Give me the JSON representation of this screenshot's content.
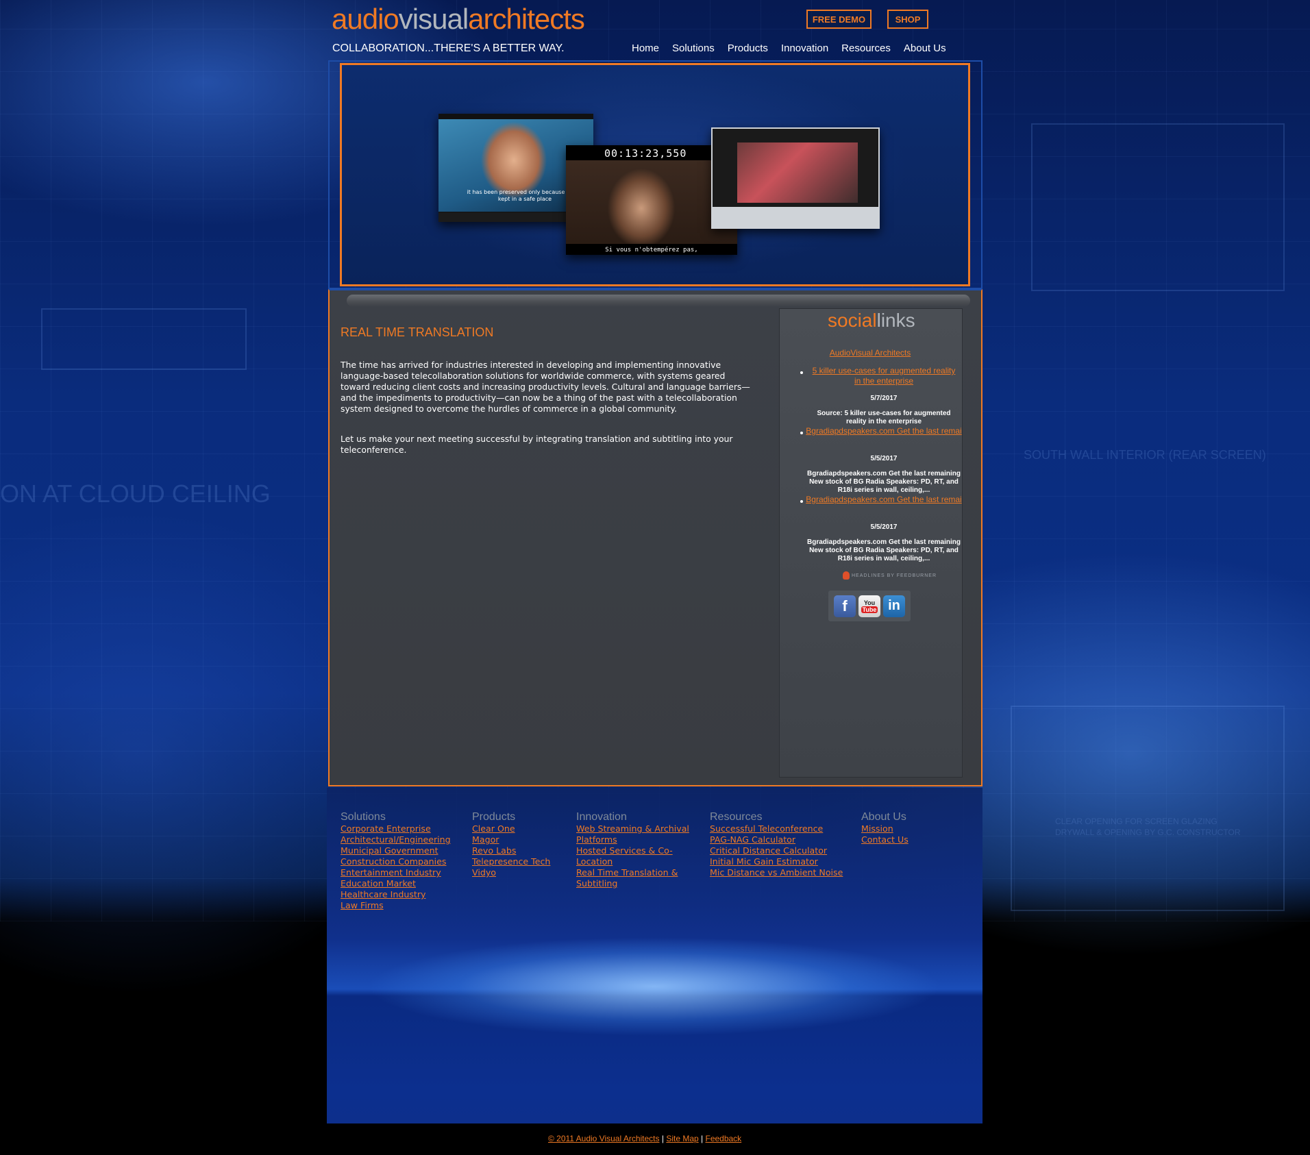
{
  "header": {
    "logo_part1": "audio",
    "logo_part2": "visual",
    "logo_part3": "architects",
    "tagline": "COLLABORATION...THERE'S A BETTER WAY.",
    "free_demo_label": "FREE DEMO",
    "shop_label": "SHOP"
  },
  "nav": {
    "items": [
      {
        "label": "Home"
      },
      {
        "label": "Solutions"
      },
      {
        "label": "Products"
      },
      {
        "label": "Innovation"
      },
      {
        "label": "Resources"
      },
      {
        "label": "About Us"
      }
    ]
  },
  "banner": {
    "video1_subtitle": "it has been preserved only because it was kept in a safe place",
    "video2_timecode": "00:13:23,550",
    "video2_subtitle": "Si vous n'obtempérez pas,"
  },
  "background_text": {
    "left": "ON AT CLOUD CEILING",
    "right": "SOUTH WALL INTERIOR (REAR SCREEN)",
    "bottom_right_1": "CLEAR OPENING FOR SCREEN GLAZING",
    "bottom_right_2": "DRYWALL & OPENING BY G.C. CONSTRUCTOR"
  },
  "main": {
    "title": "REAL TIME TRANSLATION",
    "paragraph1": "The time has arrived for industries interested in developing and implementing innovative language-based telecollaboration solutions for worldwide commerce, with systems geared toward reducing client costs and increasing productivity levels. Cultural and language barriers—and the impediments to productivity—can now be a thing of the past with a telecollaboration system designed to overcome the hurdles of commerce in a global community.",
    "paragraph2": "Let us make your next meeting successful by integrating translation and subtitling into your teleconference."
  },
  "social": {
    "title_part1": "social",
    "title_part2": "links",
    "feed_title": "AudioVisual Architects",
    "items": [
      {
        "link": "5 killer use-cases for augmented reality in the enterprise",
        "date": "5/7/2017",
        "desc": "Source: 5 killer use-cases for augmented reality in the enterprise"
      },
      {
        "link": "Bgradiapdspeakers.com Get the last remai",
        "date": "5/5/2017",
        "desc": "Bgradiapdspeakers.com Get the last remaining New stock of BG Radia Speakers: PD, RT, and R18i series in wall, ceiling,..."
      },
      {
        "link": "Bgradiapdspeakers.com Get the last remai",
        "date": "5/5/2017",
        "desc": "Bgradiapdspeakers.com Get the last remaining New stock of BG Radia Speakers: PD, RT, and R18i series in wall, ceiling,..."
      }
    ],
    "feedburner_label": "HEADLINES BY FEEDBURNER",
    "icons": [
      "facebook-icon",
      "youtube-icon",
      "linkedin-icon"
    ],
    "youtube_you": "You",
    "youtube_tube": "Tube",
    "facebook_glyph": "f",
    "linkedin_glyph": "in"
  },
  "footer": {
    "columns": [
      {
        "heading": "Solutions",
        "links": [
          "Corporate Enterprise",
          "Architectural/Engineering",
          "Municipal Government",
          "Construction Companies",
          "Entertainment Industry",
          "Education Market",
          "Healthcare Industry",
          "Law Firms"
        ]
      },
      {
        "heading": "Products",
        "links": [
          "Clear One",
          "Magor",
          "Revo Labs",
          "Telepresence Tech",
          "Vidyo"
        ]
      },
      {
        "heading": "Innovation",
        "links": [
          "Web Streaming & Archival",
          "Platforms",
          "Hosted Services & Co-",
          "Location",
          "Real Time Translation &",
          "Subtitling"
        ]
      },
      {
        "heading": "Resources",
        "links": [
          "Successful Teleconference",
          "PAG-NAG Calculator",
          "Critical Distance Calculator",
          "Initial Mic Gain Estimator",
          "Mic Distance vs Ambient Noise"
        ]
      },
      {
        "heading": "About Us",
        "links": [
          "Mission",
          "Contact Us"
        ]
      }
    ],
    "copyright": "© 2011 Audio Visual Architects",
    "separator": "|",
    "sitemap": "Site Map",
    "feedback": "Feedback"
  },
  "colors": {
    "accent": "#f07a24",
    "logo_gray": "#b2b7bd",
    "panel": "#3c4047",
    "background": "#0a2c7d"
  }
}
